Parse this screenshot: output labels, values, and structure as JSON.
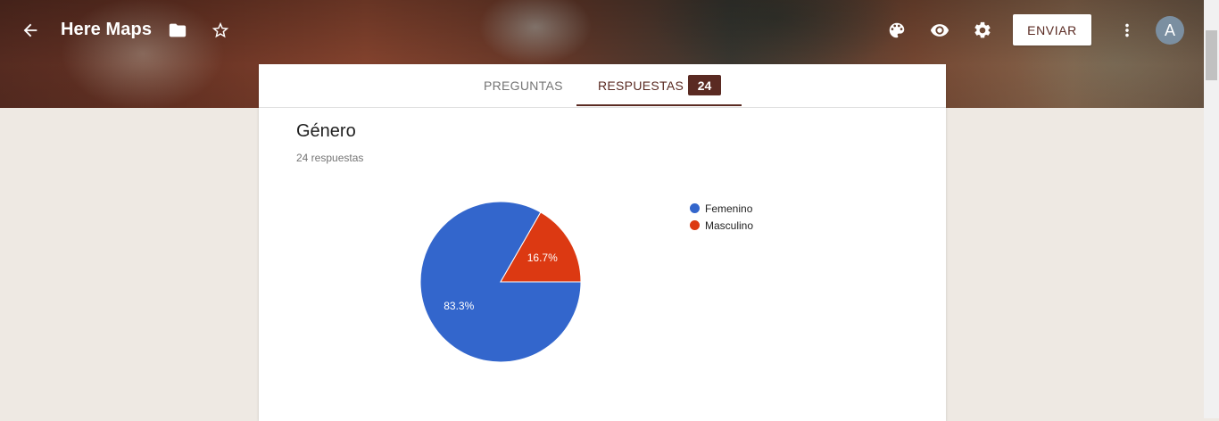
{
  "header": {
    "title": "Here Maps",
    "send_label": "ENVIAR",
    "avatar_letter": "A",
    "icons": [
      "back-arrow-icon",
      "folder-icon",
      "star-icon",
      "palette-icon",
      "eye-icon",
      "gear-icon",
      "more-vert-icon"
    ]
  },
  "tabs": {
    "questions_label": "PREGUNTAS",
    "responses_label": "RESPUESTAS",
    "responses_count": "24"
  },
  "question": {
    "title": "Género",
    "response_count_text": "24 respuestas"
  },
  "chart_data": {
    "type": "pie",
    "title": "",
    "slices": [
      {
        "label": "Femenino",
        "value": 83.3,
        "display": "83.3%",
        "color": "#3366cc"
      },
      {
        "label": "Masculino",
        "value": 16.7,
        "display": "16.7%",
        "color": "#dc3912"
      }
    ],
    "legend_position": "right"
  }
}
